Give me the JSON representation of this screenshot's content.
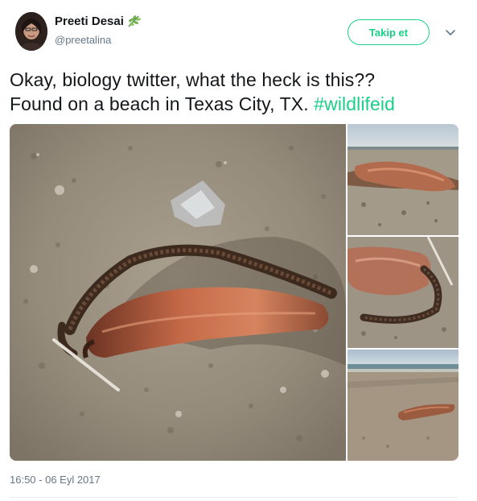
{
  "user": {
    "display_name": "Preeti Desai",
    "username": "@preetalina",
    "badge_icon": "leaf-icon"
  },
  "actions": {
    "follow_label": "Takip et",
    "menu_icon": "chevron-down-icon"
  },
  "tweet": {
    "text_line1": "Okay, biology twitter, what the heck is this??",
    "text_line2_prefix": "Found on a beach in Texas City, TX.",
    "hashtag": "#wildlifeid",
    "timestamp": "16:50 - 06 Eyl 2017"
  },
  "colors": {
    "accent": "#19cf86",
    "secondary_text": "#657786",
    "primary_text": "#14171a"
  }
}
